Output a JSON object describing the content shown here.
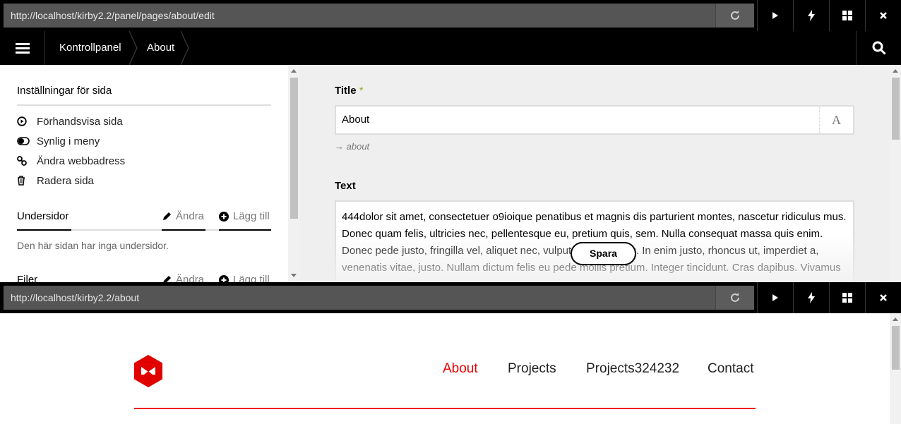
{
  "browser_top": {
    "url": "http://localhost/kirby2.2/panel/pages/about/edit"
  },
  "panel": {
    "breadcrumbs": [
      "Kontrollpanel",
      "About"
    ]
  },
  "sidebar": {
    "settings_title": "Inställningar för sida",
    "actions": [
      {
        "label": "Förhandsvisa sida",
        "icon": "play-circle-icon"
      },
      {
        "label": "Synlig i meny",
        "icon": "toggle-icon"
      },
      {
        "label": "Ändra webbadress",
        "icon": "chain-icon"
      },
      {
        "label": "Radera sida",
        "icon": "trash-icon"
      }
    ],
    "subpages": {
      "title": "Undersidor",
      "edit_label": "Ändra",
      "add_label": "Lägg till",
      "empty_text": "Den här sidan har inga undersidor."
    },
    "files": {
      "title": "Filer",
      "edit_label": "Ändra",
      "add_label": "Lägg till"
    }
  },
  "editor": {
    "title_label": "Title",
    "required_mark": "*",
    "title_value": "About",
    "slug": "about",
    "text_label": "Text",
    "text_value": "444dolor sit amet, consectetuer o9ioique penatibus et magnis dis parturient montes, nascetur ridiculus mus. Donec quam felis, ultricies nec, pellentesque eu, pretium quis, sem. Nulla consequat massa quis enim. Donec pede justo, fringilla vel, aliquet nec, vulputate eget, arcu. In enim justo, rhoncus ut, imperdiet a, venenatis vitae, justo. Nullam dictum felis eu pede mollis pretium. Integer tincidunt. Cras dapibus. Vivamus",
    "save_label": "Spara"
  },
  "browser_bottom": {
    "url": "http://localhost/kirby2.2/about"
  },
  "site": {
    "nav": [
      "About",
      "Projects",
      "Projects324232",
      "Contact"
    ],
    "active_nav": "About",
    "accent_color": "#e00000"
  }
}
